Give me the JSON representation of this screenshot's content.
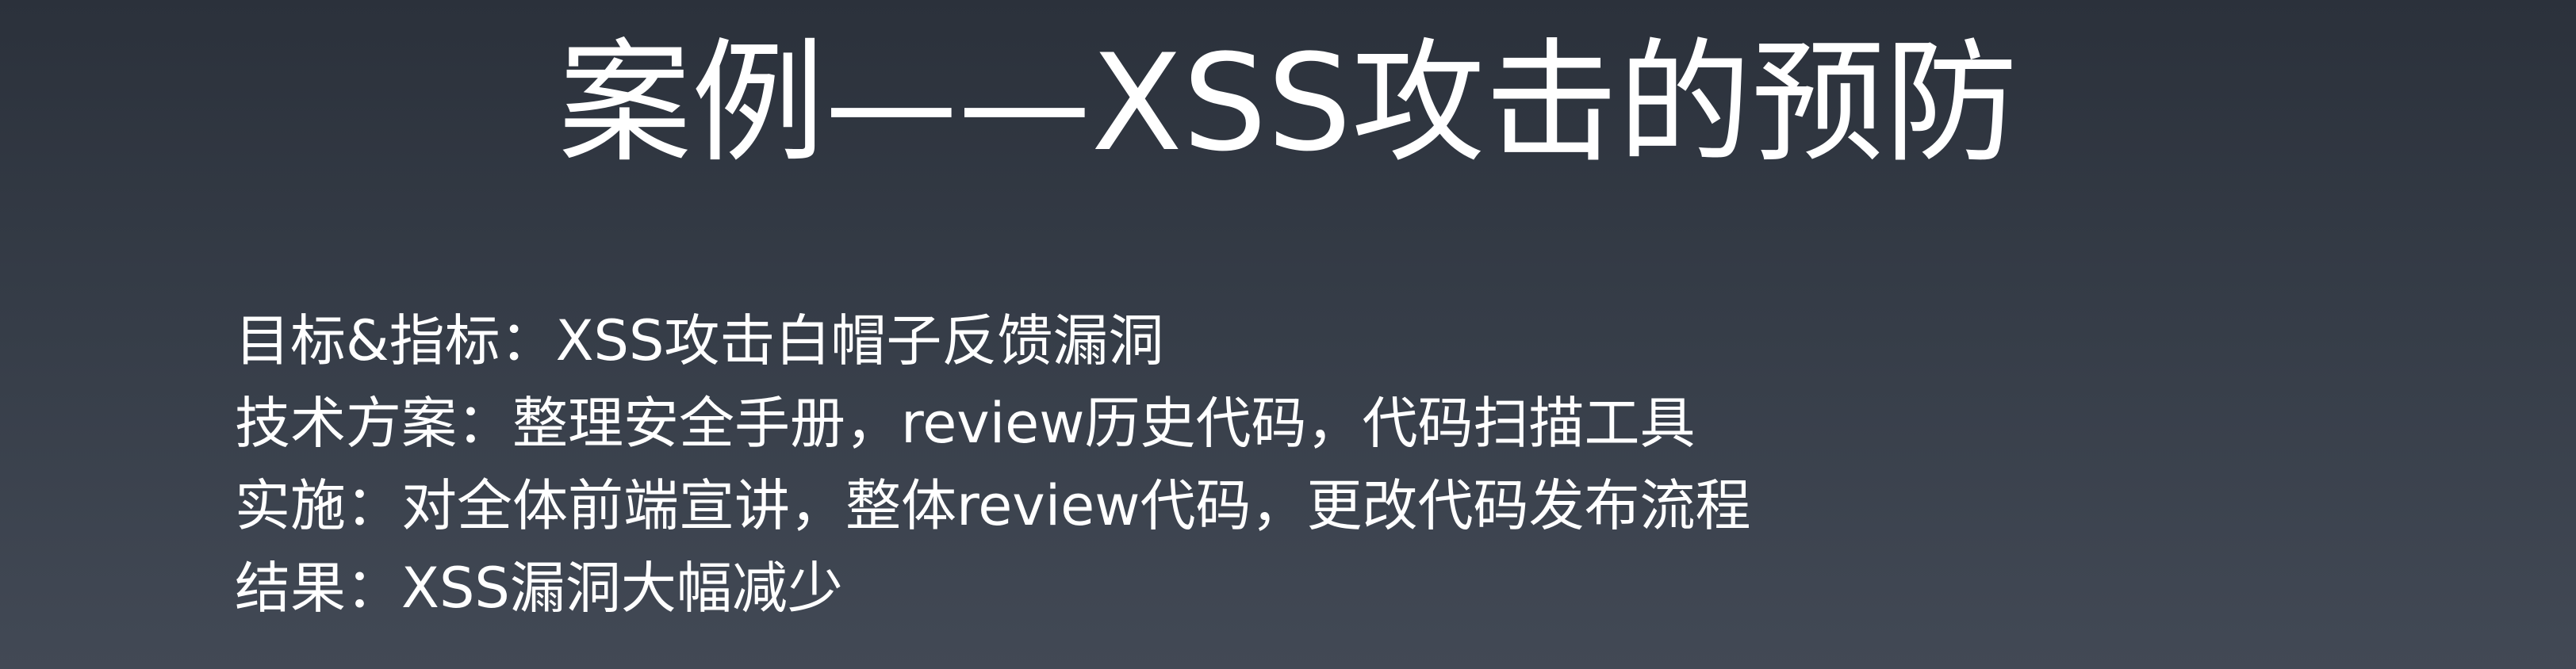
{
  "slide": {
    "title": "案例——XSS攻击的预防",
    "bullets": [
      "目标&指标：XSS攻击白帽子反馈漏洞",
      "技术方案：整理安全手册，review历史代码，代码扫描工具",
      "实施：对全体前端宣讲，整体review代码，更改代码发布流程",
      "结果：XSS漏洞大幅减少"
    ]
  }
}
